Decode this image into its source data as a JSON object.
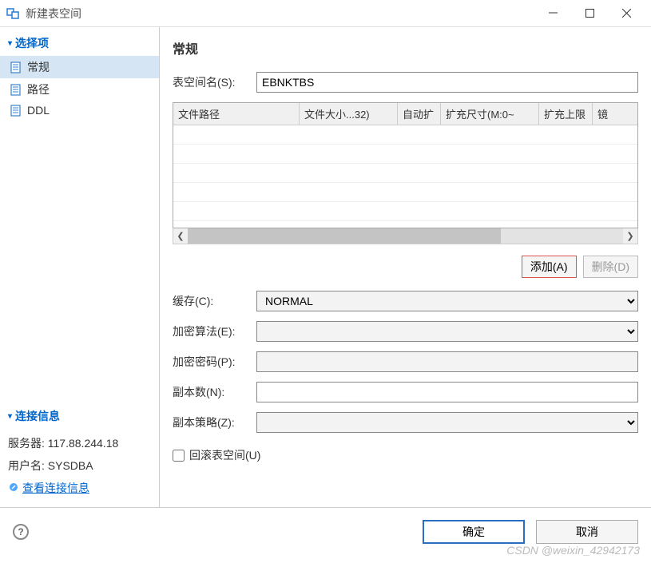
{
  "window": {
    "title": "新建表空间"
  },
  "sidebar": {
    "options_title": "选择项",
    "items": [
      {
        "label": "常规"
      },
      {
        "label": "路径"
      },
      {
        "label": "DDL"
      }
    ],
    "conn_title": "连接信息",
    "server_label": "服务器: 117.88.244.18",
    "user_label": "用户名: SYSDBA",
    "view_link": "查看连接信息"
  },
  "content": {
    "title": "常规",
    "name_label": "表空间名(S):",
    "name_value": "EBNKTBS",
    "columns": [
      "文件路径",
      "文件大小...32)",
      "自动扩",
      "扩充尺寸(M:0~",
      "扩充上限",
      "镜"
    ],
    "add_btn": "添加(A)",
    "delete_btn": "删除(D)",
    "cache_label": "缓存(C):",
    "cache_value": "NORMAL",
    "enc_algo_label": "加密算法(E):",
    "enc_algo_value": "",
    "enc_pwd_label": "加密密码(P):",
    "enc_pwd_value": "",
    "replica_label": "副本数(N):",
    "replica_value": "",
    "policy_label": "副本策略(Z):",
    "policy_value": "",
    "rollback_label": "回滚表空间(U)"
  },
  "footer": {
    "ok": "确定",
    "cancel": "取消"
  },
  "watermark": "CSDN @weixin_42942173"
}
